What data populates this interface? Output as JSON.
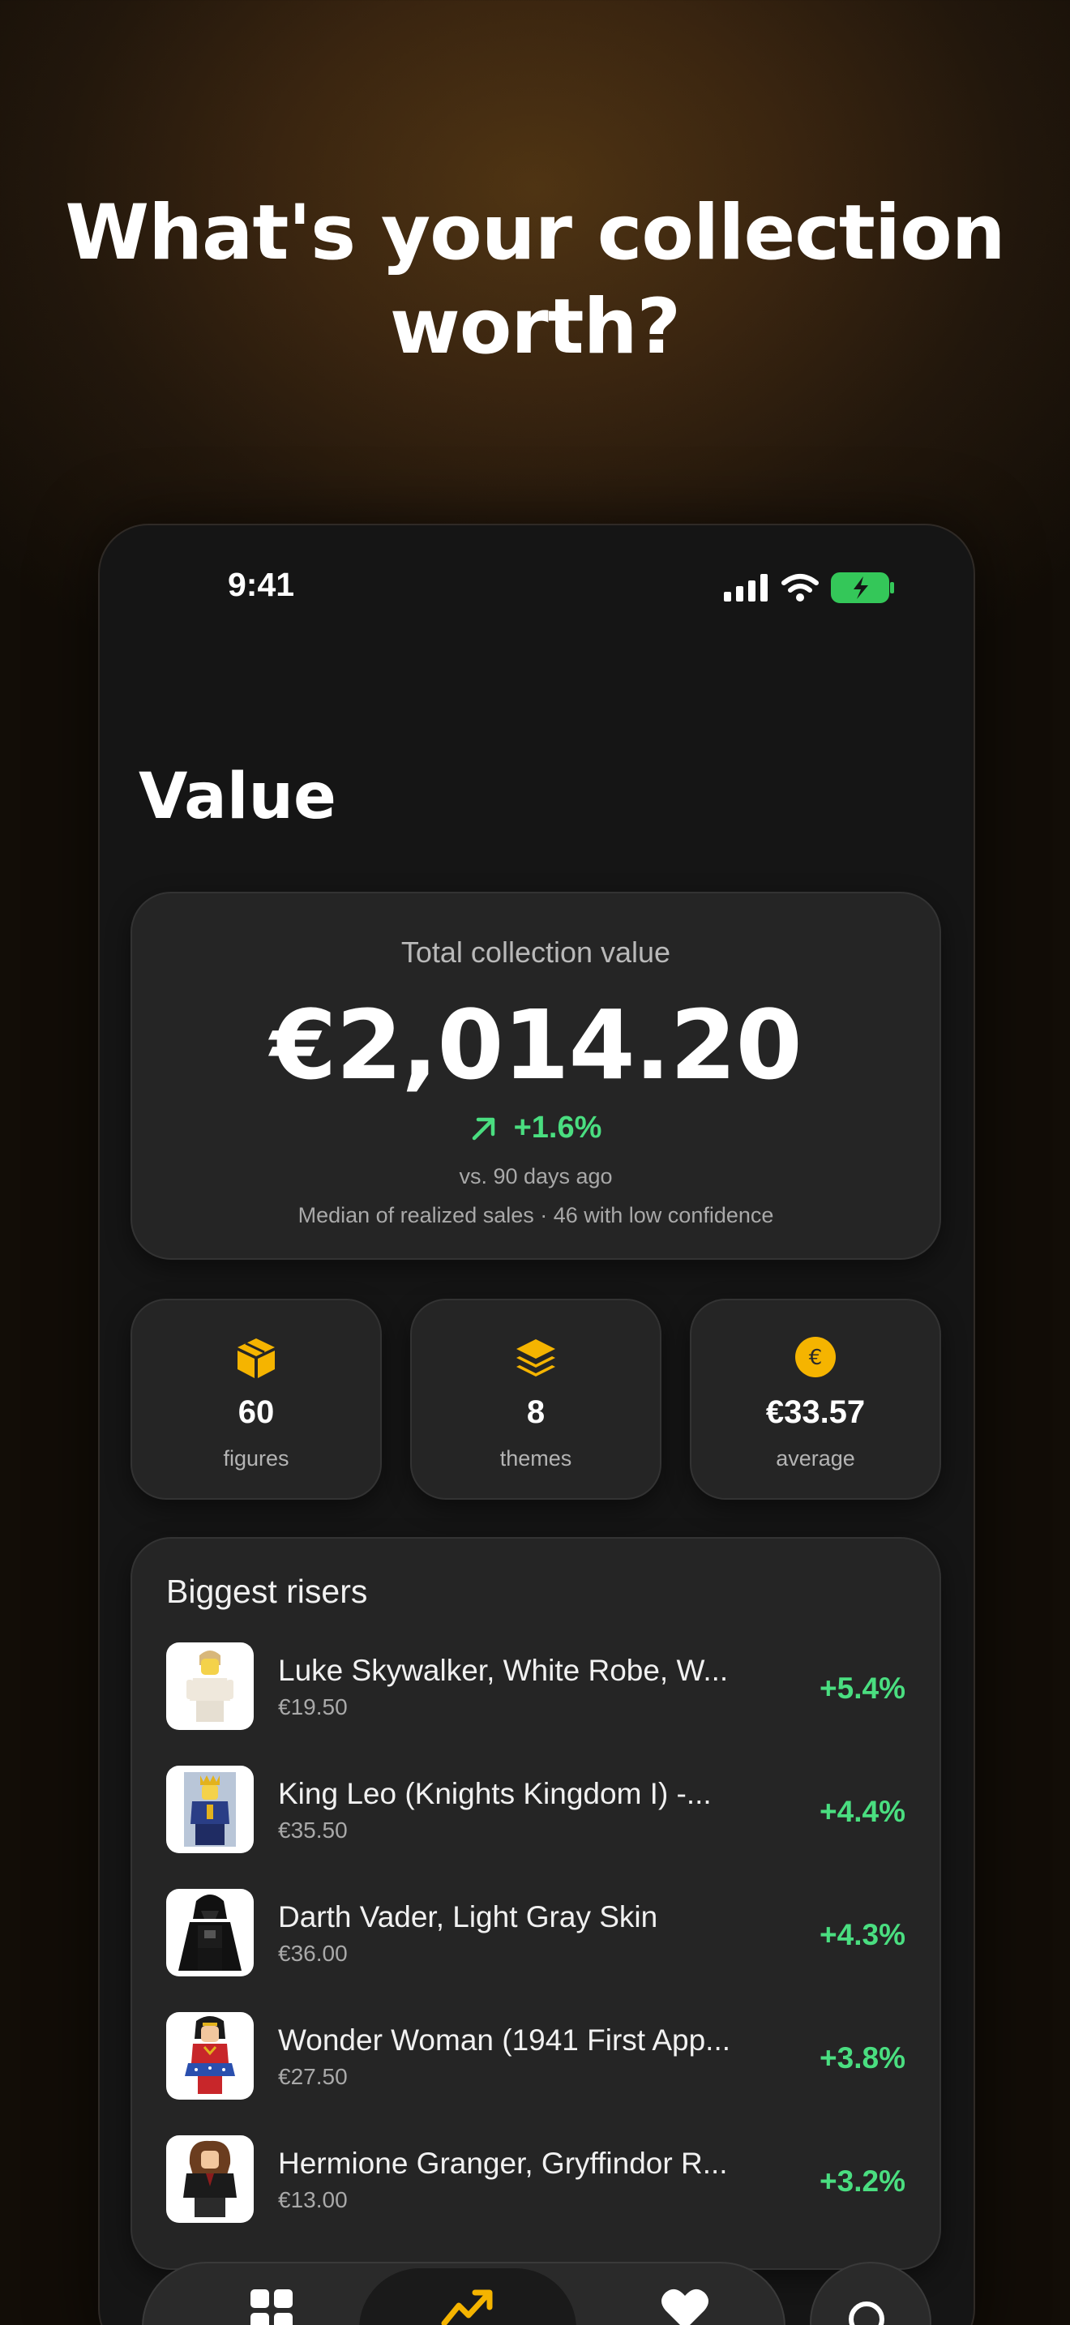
{
  "hero": {
    "line1": "What's your collection",
    "line2": "worth?"
  },
  "status_bar": {
    "time": "9:41",
    "icons": [
      "signal-icon",
      "wifi-icon",
      "battery-charging-icon"
    ]
  },
  "page": {
    "title": "Value"
  },
  "total": {
    "label": "Total collection value",
    "value": "€2,014.20",
    "change": "+1.6%",
    "compare": "vs. 90 days ago",
    "note": "Median of realized sales · 46 with low confidence"
  },
  "stats": [
    {
      "icon": "box-icon",
      "value": "60",
      "label": "figures"
    },
    {
      "icon": "layers-icon",
      "value": "8",
      "label": "themes"
    },
    {
      "icon": "euro-coin-icon",
      "value": "€33.57",
      "label": "average"
    }
  ],
  "risers": {
    "title": "Biggest risers",
    "items": [
      {
        "name": "Luke Skywalker, White Robe, W...",
        "price": "€19.50",
        "change": "+5.4%"
      },
      {
        "name": "King Leo (Knights Kingdom I) -...",
        "price": "€35.50",
        "change": "+4.4%"
      },
      {
        "name": "Darth Vader, Light Gray Skin",
        "price": "€36.00",
        "change": "+4.3%"
      },
      {
        "name": "Wonder Woman (1941 First App...",
        "price": "€27.50",
        "change": "+3.8%"
      },
      {
        "name": "Hermione Granger, Gryffindor R...",
        "price": "€13.00",
        "change": "+3.2%"
      }
    ]
  },
  "tabbar": {
    "tabs": [
      "grid-icon",
      "trend-up-icon",
      "heart-icon"
    ],
    "active": "trend-up-icon",
    "search_icon": "search-icon"
  },
  "colors": {
    "accent": "#f5b400",
    "positive": "#4ade80",
    "card": "#252525",
    "screen": "#151515"
  }
}
